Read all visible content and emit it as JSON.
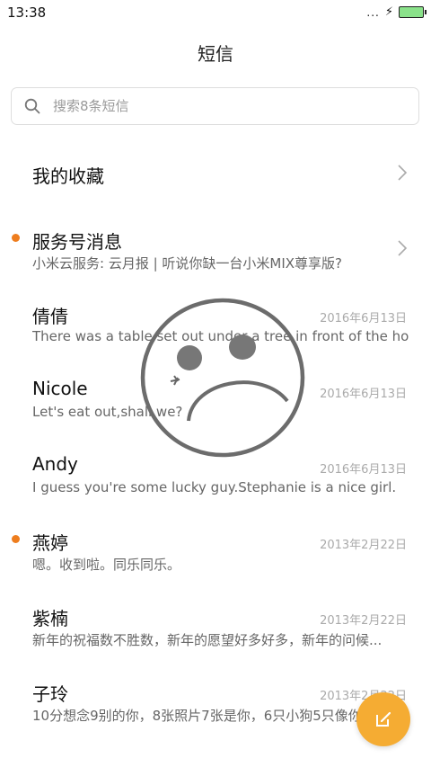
{
  "status_bar": {
    "time": "13:38",
    "signal_dots": "...",
    "battery_color": "#8ae28a"
  },
  "header": {
    "title": "短信"
  },
  "search": {
    "placeholder": "搜索8条短信"
  },
  "favorites": {
    "label": "我的收藏"
  },
  "service": {
    "title": "服务号消息",
    "preview": "小米云服务: 云月报 | 听说你缺一台小米MIX尊享版?",
    "unread": true
  },
  "messages": [
    {
      "name": "倩倩",
      "date": "2016年6月13日",
      "preview": "There was a table set out under a tree in front of the ho...",
      "unread": false
    },
    {
      "name": "Nicole",
      "date": "2016年6月13日",
      "preview": "Let's eat out,shall we?",
      "unread": false
    },
    {
      "name": "Andy",
      "date": "2016年6月13日",
      "preview": "I guess you're some lucky guy.Stephanie is a nice girl.",
      "unread": false
    },
    {
      "name": "燕婷",
      "date": "2013年2月22日",
      "preview": "嗯。收到啦。同乐同乐。",
      "unread": true
    },
    {
      "name": "紫楠",
      "date": "2013年2月22日",
      "preview": "新年的祝福数不胜数，新年的愿望好多好多，新年的问候...",
      "unread": false
    },
    {
      "name": "子玲",
      "date": "2013年2月22日",
      "preview": "10分想念9别的你，8张照片7张是你，6只小狗5只像你...",
      "unread": false
    }
  ],
  "icons": {
    "search": "search-icon",
    "chevron": "chevron-right-icon",
    "compose": "compose-icon",
    "overlay": "sad-face-icon"
  },
  "colors": {
    "accent": "#f5ac33",
    "unread_dot": "#ee7d1e"
  }
}
